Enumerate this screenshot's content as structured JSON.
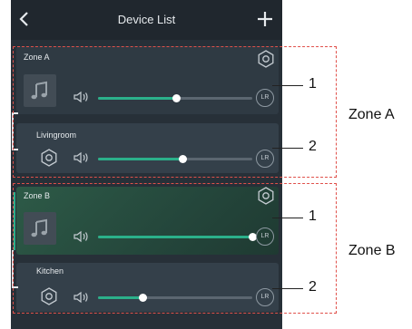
{
  "header": {
    "title": "Device List",
    "back_icon": "chevron-left-icon",
    "add_icon": "plus-icon"
  },
  "zones": [
    {
      "name": "Zone A",
      "volume": 0.51,
      "channel": "LR",
      "rooms": [
        {
          "name": "Livingroom",
          "volume": 0.55,
          "channel": "LR"
        }
      ]
    },
    {
      "name": "Zone B",
      "volume": 1.0,
      "channel": "LR",
      "rooms": [
        {
          "name": "Kitchen",
          "volume": 0.29,
          "channel": "LR"
        }
      ]
    }
  ],
  "annotations": {
    "callout_1": "1",
    "callout_2": "2",
    "zone_a_label": "Zone A",
    "zone_b_label": "Zone B"
  },
  "colors": {
    "accent": "#2bb08a",
    "annotation_dash": "#e0504a"
  }
}
